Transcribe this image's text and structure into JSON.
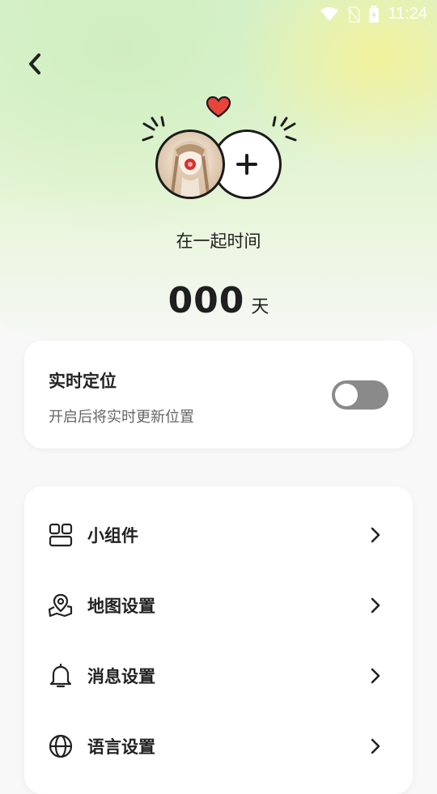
{
  "status": {
    "time": "11:24"
  },
  "header": {
    "back_icon": "chevron-left-icon"
  },
  "couple": {
    "heart_color": "#e8443a",
    "together_label": "在一起时间",
    "days_count": "000",
    "days_unit": "天"
  },
  "location": {
    "title": "实时定位",
    "subtitle": "开启后将实时更新位置",
    "enabled": false
  },
  "menu": [
    {
      "label": "小组件",
      "icon": "widgets-icon"
    },
    {
      "label": "地图设置",
      "icon": "map-pin-icon"
    },
    {
      "label": "消息设置",
      "icon": "bell-icon"
    },
    {
      "label": "语言设置",
      "icon": "globe-icon"
    }
  ]
}
